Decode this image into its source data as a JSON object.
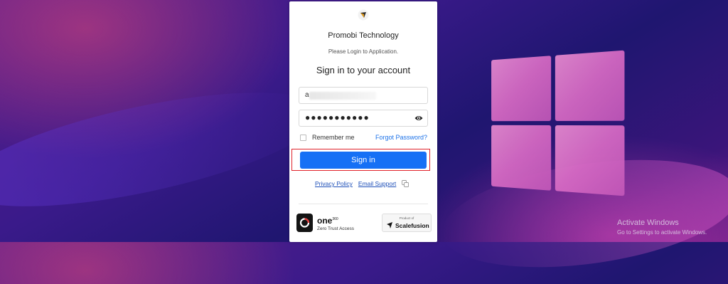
{
  "login": {
    "org_name": "Promobi Technology",
    "subtitle": "Please Login to Application.",
    "heading": "Sign in to your account",
    "username_value": "a",
    "password_value": "●●●●●●●●●●●",
    "remember_label": "Remember me",
    "forgot_label": "Forgot Password?",
    "signin_label": "Sign in",
    "privacy_label": "Privacy Policy",
    "email_support_label": "Email Support",
    "accent_color": "#1670f5"
  },
  "footer": {
    "one_brand": "one",
    "one_sup": "360",
    "one_subtitle": "Zero Trust Access",
    "sf_tiny": "Product of",
    "sf_name": "Scalefusion"
  },
  "watermark": {
    "title": "Activate Windows",
    "subtitle": "Go to Settings to activate Windows."
  },
  "icons": [
    "app-logo-icon",
    "eye-icon",
    "copy-icon",
    "one-logo-icon",
    "scalefusion-icon",
    "windows-logo"
  ]
}
